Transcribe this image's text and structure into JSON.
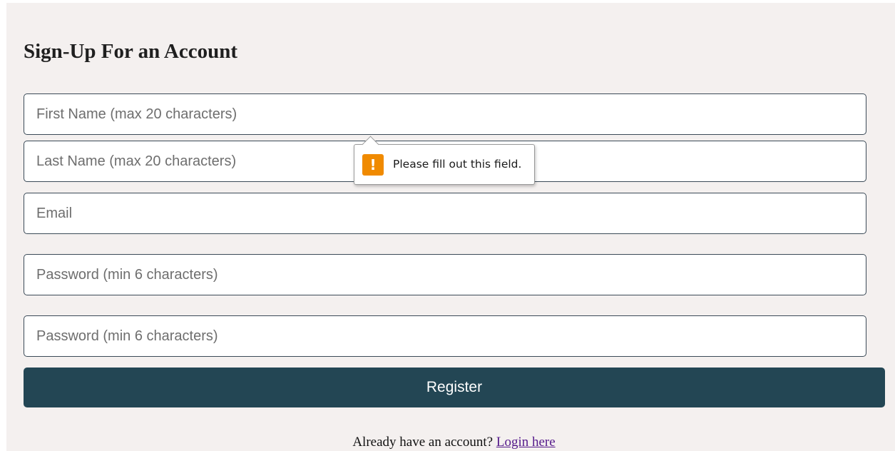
{
  "form": {
    "title": "Sign-Up For an Account",
    "first_name_placeholder": "First Name (max 20 characters)",
    "last_name_placeholder": "Last Name (max 20 characters)",
    "email_placeholder": "Email",
    "password_placeholder": "Password (min 6 characters)",
    "confirm_password_placeholder": "Password (min 6 characters)",
    "register_label": "Register"
  },
  "footer": {
    "prompt": "Already have an account?",
    "login_link": "Login here"
  },
  "validation": {
    "message": "Please fill out this field.",
    "icon": "warning-exclamation-icon",
    "icon_glyph": "!"
  },
  "colors": {
    "background": "#f4f0ef",
    "button": "#234654",
    "warning": "#f08a00",
    "link": "#551a8b"
  }
}
